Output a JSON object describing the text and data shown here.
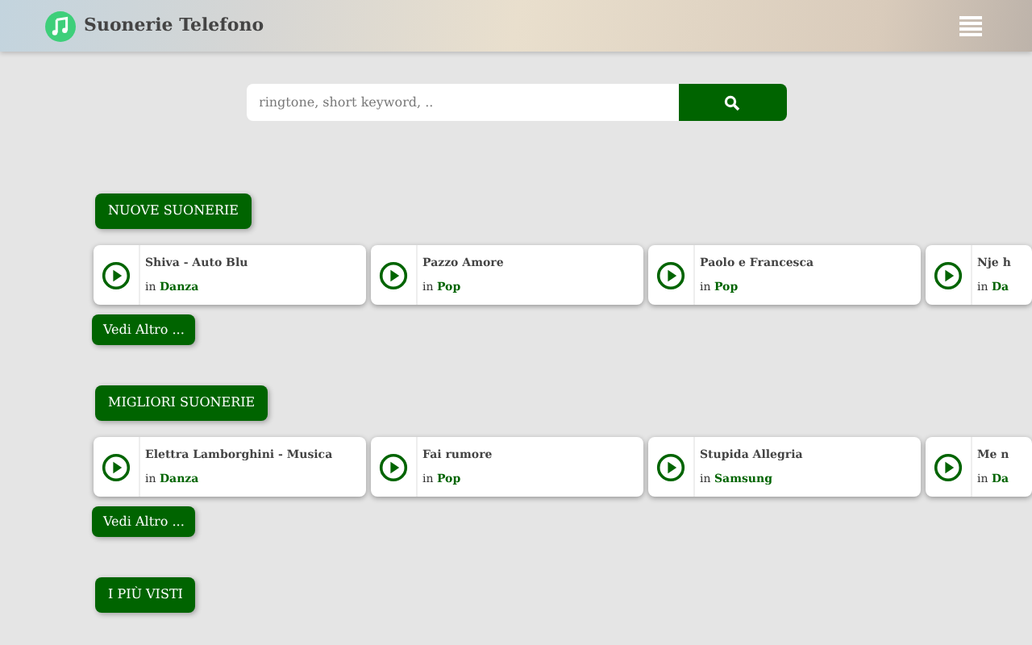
{
  "header": {
    "title": "Suonerie Telefono"
  },
  "search": {
    "placeholder": "ringtone, short keyword, .."
  },
  "sections": [
    {
      "title": "NUOVE SUONERIE",
      "more": "Vedi Altro ...",
      "cards": [
        {
          "name": "Shiva - Auto Blu",
          "prefix": "in",
          "category": "Danza"
        },
        {
          "name": "Pazzo Amore",
          "prefix": "in",
          "category": "Pop"
        },
        {
          "name": "Paolo e Francesca",
          "prefix": "in",
          "category": "Pop"
        },
        {
          "name": "Nje h",
          "prefix": "in",
          "category": "Da"
        }
      ]
    },
    {
      "title": "MIGLIORI SUONERIE",
      "more": "Vedi Altro ...",
      "cards": [
        {
          "name": "Elettra Lamborghini - Musica",
          "prefix": "in",
          "category": "Danza"
        },
        {
          "name": "Fai rumore",
          "prefix": "in",
          "category": "Pop"
        },
        {
          "name": "Stupida Allegria",
          "prefix": "in",
          "category": "Samsung"
        },
        {
          "name": "Me n",
          "prefix": "in",
          "category": "Da"
        }
      ]
    },
    {
      "title": "I PIÙ VISTI"
    }
  ]
}
